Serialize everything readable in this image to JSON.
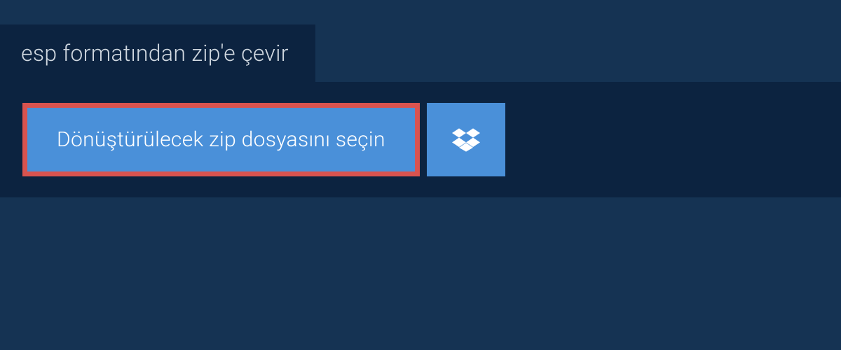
{
  "tab": {
    "label": "esp formatından zip'e çevir"
  },
  "panel": {
    "select_file_label": "Dönüştürülecek zip dosyasını seçin"
  },
  "colors": {
    "background": "#153353",
    "panel": "#0c2340",
    "button": "#4a90d9",
    "highlight_border": "#d9534f"
  }
}
